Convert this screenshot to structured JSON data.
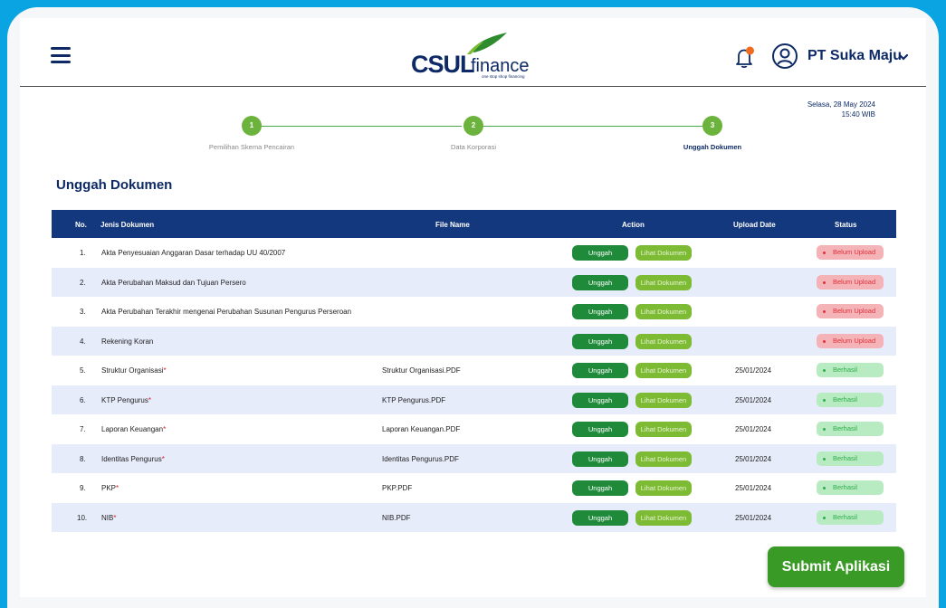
{
  "brand": {
    "logo_main": "CSUL",
    "logo_sub": "finance",
    "logo_tagline": "one stop shop financing",
    "primary_color": "#0d2a66",
    "accent_color": "#6cb33e",
    "frame_color": "#0aa4e2"
  },
  "header": {
    "company_name": "PT Suka Maju",
    "icons": [
      "menu-icon",
      "bell-icon",
      "user-icon",
      "chevron-down-icon"
    ]
  },
  "datetime": {
    "date": "Selasa, 28 May 2024",
    "time": "15:40 WIB"
  },
  "stepper": [
    {
      "number": "1",
      "label": "Pemilihan Skema Pencairan"
    },
    {
      "number": "2",
      "label": "Data Korporasi"
    },
    {
      "number": "3",
      "label": "Unggah Dokumen"
    }
  ],
  "page_title": "Unggah Dokumen",
  "table": {
    "headers": {
      "no": "No.",
      "jenis": "Jenis Dokumen",
      "file": "File Name",
      "action": "Action",
      "date": "Upload Date",
      "status": "Status"
    },
    "upload_label": "Unggah",
    "view_label": "Lihat Dokumen",
    "rows": [
      {
        "no": "1.",
        "jenis": "Akta Penyesuaian Anggaran Dasar terhadap UU 40/2007",
        "required": "",
        "file": "",
        "date": "",
        "status": "Belum Upload"
      },
      {
        "no": "2.",
        "jenis": "Akta Perubahan Maksud dan Tujuan Persero",
        "required": "",
        "file": "",
        "date": "",
        "status": "Belum Upload"
      },
      {
        "no": "3.",
        "jenis": "Akta Perubahan Terakhir mengenai Perubahan Susunan Pengurus Perseroan",
        "required": "",
        "file": "",
        "date": "",
        "status": "Belum Upload"
      },
      {
        "no": "4.",
        "jenis": "Rekening Koran",
        "required": "",
        "file": "",
        "date": "",
        "status": "Belum Upload"
      },
      {
        "no": "5.",
        "jenis": "Struktur Organisasi",
        "required": "*",
        "file": "Struktur Organisasi.PDF",
        "date": "25/01/2024",
        "status": "Berhasil"
      },
      {
        "no": "6.",
        "jenis": "KTP Pengurus",
        "required": "*",
        "file": "KTP Pengurus.PDF",
        "date": "25/01/2024",
        "status": "Berhasil"
      },
      {
        "no": "7.",
        "jenis": "Laporan Keuangan",
        "required": "*",
        "file": "Laporan Keuangan.PDF",
        "date": "25/01/2024",
        "status": "Berhasil"
      },
      {
        "no": "8.",
        "jenis": "Identitas Pengurus",
        "required": "*",
        "file": "Identitas Pengurus.PDF",
        "date": "25/01/2024",
        "status": "Berhasil"
      },
      {
        "no": "9.",
        "jenis": "PKP",
        "required": "*",
        "file": "PKP.PDF",
        "date": "25/01/2024",
        "status": "Berhasil"
      },
      {
        "no": "10.",
        "jenis": "NIB",
        "required": "*",
        "file": "NIB.PDF",
        "date": "25/01/2024",
        "status": "Berhasil"
      }
    ]
  },
  "submit_label": "Submit Aplikasi"
}
